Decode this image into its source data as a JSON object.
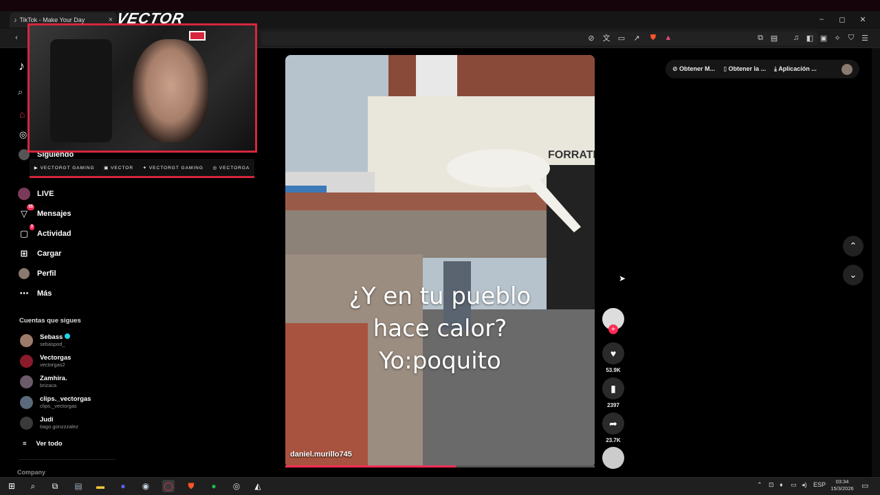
{
  "browser": {
    "tab_title": "TikTok - Make Your Day",
    "tab_close": "×",
    "window_buttons": [
      "–",
      "◻",
      "✕"
    ]
  },
  "overlay": {
    "logo": "VECTOR",
    "socials": [
      "VECTORGT GAMING",
      "VECTOR",
      "VECTORGT GAMING",
      "VECTORGA"
    ]
  },
  "sidebar": {
    "logo": "♪",
    "items": [
      {
        "label": "Siguiendo",
        "icon": "following-icon"
      },
      {
        "label": "LIVE",
        "icon": "live-icon"
      },
      {
        "label": "Mensajes",
        "icon": "messages-icon",
        "badge": "55"
      },
      {
        "label": "Actividad",
        "icon": "activity-icon",
        "badge": "3"
      },
      {
        "label": "Cargar",
        "icon": "upload-icon"
      },
      {
        "label": "Perfil",
        "icon": "profile-icon"
      },
      {
        "label": "Más",
        "icon": "more-icon"
      }
    ],
    "following_title": "Cuentas que sigues",
    "accounts": [
      {
        "name": "Sebass",
        "handle": "sebaspod_",
        "verified": true
      },
      {
        "name": "Vectorgas",
        "handle": "vectorgas2"
      },
      {
        "name": "Zamhira.",
        "handle": "brizaca"
      },
      {
        "name": "clips._vectorgas",
        "handle": "clips._vectorgas"
      },
      {
        "name": "Judi",
        "handle": "tiago.gonzzzalez"
      }
    ],
    "see_all": "Ver todo",
    "footer": "Company"
  },
  "video": {
    "caption_lines": [
      "¿Y en tu pueblo",
      "hace calor?",
      "Yo:poquito"
    ],
    "author": "daniel.murillo745",
    "sign_text": "FORRATERA",
    "progress": 0.55
  },
  "actions": {
    "likes": "53.9K",
    "saves": "2397",
    "shares": "23.7K"
  },
  "top_right": {
    "buttons": [
      "Obtener M...",
      "Obtener la ...",
      "Aplicación ..."
    ]
  },
  "taskbar": {
    "language": "ESP",
    "time": "03:34",
    "date": "15/3/2026"
  }
}
